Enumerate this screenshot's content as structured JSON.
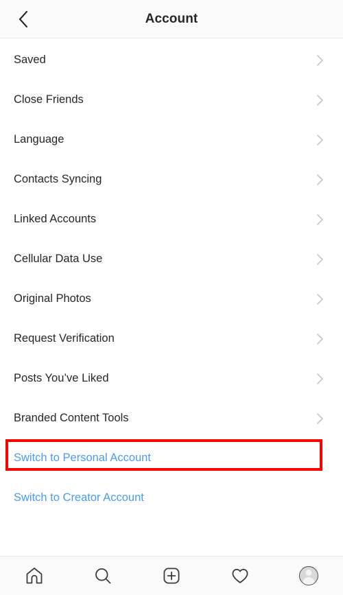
{
  "header": {
    "title": "Account",
    "back_icon": "chevron-left-icon"
  },
  "list": {
    "chevron_icon": "chevron-right-icon",
    "items": [
      {
        "label": "Saved"
      },
      {
        "label": "Close Friends"
      },
      {
        "label": "Language"
      },
      {
        "label": "Contacts Syncing"
      },
      {
        "label": "Linked Accounts"
      },
      {
        "label": "Cellular Data Use"
      },
      {
        "label": "Original Photos"
      },
      {
        "label": "Request Verification"
      },
      {
        "label": "Posts You’ve Liked"
      },
      {
        "label": "Branded Content Tools"
      }
    ],
    "actions": [
      {
        "label": "Switch to Personal Account",
        "highlighted": true
      },
      {
        "label": "Switch to Creator Account",
        "highlighted": false
      }
    ]
  },
  "annotation": {
    "color": "#fc0000",
    "target": "Switch to Personal Account"
  },
  "tabbar": {
    "items": [
      {
        "name": "home-icon",
        "label": "Home"
      },
      {
        "name": "search-icon",
        "label": "Search"
      },
      {
        "name": "add-post-icon",
        "label": "New Post"
      },
      {
        "name": "heart-icon",
        "label": "Activity"
      },
      {
        "name": "profile-avatar-icon",
        "label": "Profile"
      }
    ]
  },
  "colors": {
    "text": "#262626",
    "link": "#4a9cf0",
    "chevron": "#c7c7c7",
    "header_bg": "#fafafa",
    "annotation": "#fc0000"
  }
}
